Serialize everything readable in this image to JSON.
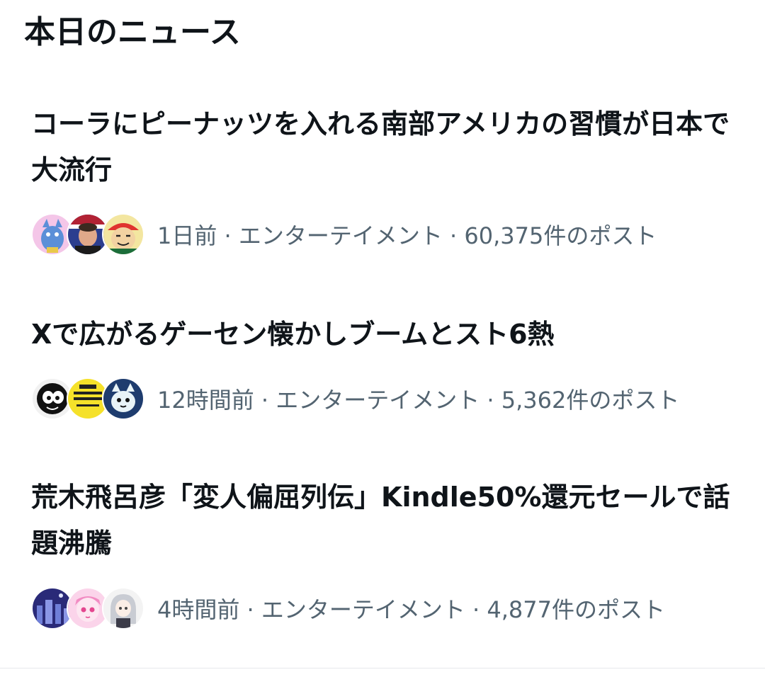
{
  "section": {
    "title": "本日のニュース"
  },
  "news": [
    {
      "headline": "コーラにピーナッツを入れる南部アメリカの習慣が日本で大流行",
      "meta": "1日前 · エンターテイメント · 60,375件のポスト",
      "avatars": [
        "blue-dragon-avatar",
        "man-portrait-avatar",
        "red-cap-cartoon-avatar"
      ]
    },
    {
      "headline": "Xで広がるゲーセン懐かしブームとスト6熱",
      "meta": "12時間前 · エンターテイメント · 5,362件のポスト",
      "avatars": [
        "cartoon-face-avatar",
        "yellow-logo-avatar",
        "cat-avatar"
      ]
    },
    {
      "headline": "荒木飛呂彦「変人偏屈列伝」Kindle50%還元セールで話題沸騰",
      "meta": "4時間前 · エンターテイメント · 4,877件のポスト",
      "avatars": [
        "night-city-avatar",
        "pink-anime-avatar",
        "silver-hair-anime-avatar"
      ]
    }
  ],
  "colors": {
    "text_primary": "#0f1419",
    "text_secondary": "#536471",
    "divider": "#e6e9ec"
  }
}
